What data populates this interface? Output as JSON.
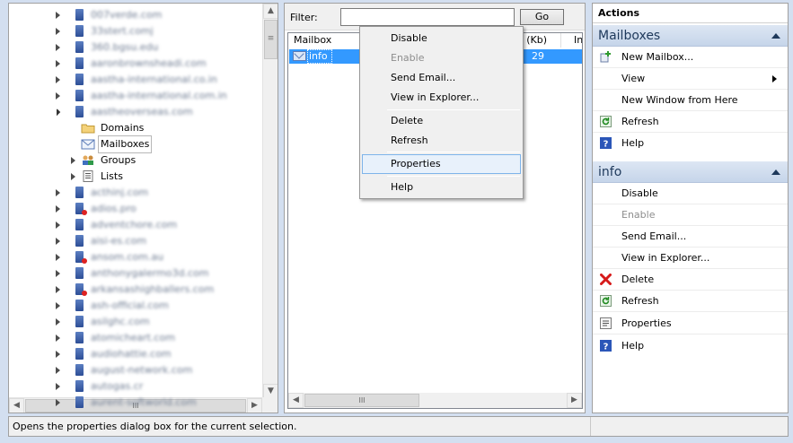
{
  "tree": {
    "domains_before": [
      "007verde.com",
      "33stert.comj",
      "360.bgsu.edu",
      "aaronbrownsheadi.com",
      "aastha-international.co.in",
      "aastha-international.com.in",
      "aastheoverseas.com"
    ],
    "children": [
      {
        "label": "Domains",
        "icon": "folder-icon"
      },
      {
        "label": "Mailboxes",
        "icon": "mailboxes-icon"
      },
      {
        "label": "Groups",
        "icon": "groups-icon"
      },
      {
        "label": "Lists",
        "icon": "lists-icon"
      }
    ],
    "domains_after": [
      {
        "label": "acthinj.com",
        "disabled": false
      },
      {
        "label": "adios.pro",
        "disabled": true
      },
      {
        "label": "adventchore.com",
        "disabled": false
      },
      {
        "label": "aisi-es.com",
        "disabled": false
      },
      {
        "label": "ansom.com.au",
        "disabled": true
      },
      {
        "label": "anthonygalermo3d.com",
        "disabled": false
      },
      {
        "label": "arkansashighballers.com",
        "disabled": true
      },
      {
        "label": "ash-official.com",
        "disabled": false
      },
      {
        "label": "asilghc.com",
        "disabled": false
      },
      {
        "label": "atomicheart.com",
        "disabled": false
      },
      {
        "label": "audiohattie.com",
        "disabled": false
      },
      {
        "label": "august-network.com",
        "disabled": false
      },
      {
        "label": "autogas.cr",
        "disabled": false
      },
      {
        "label": "aurent-softworld.com",
        "disabled": false
      }
    ]
  },
  "filter": {
    "label": "Filter:",
    "value": "",
    "go_label": "Go"
  },
  "list": {
    "columns": [
      "Mailbox",
      "ge (Kb)",
      "Inb"
    ],
    "rows": [
      {
        "name": "info",
        "size": "29"
      }
    ]
  },
  "context_menu": {
    "items": [
      "Disable",
      "Enable",
      "Send Email...",
      "View in Explorer...",
      "Delete",
      "Refresh",
      "Properties",
      "Help"
    ],
    "disabled": [
      "Enable"
    ],
    "hovered": "Properties"
  },
  "actions": {
    "title": "Actions",
    "groups": [
      {
        "header": "Mailboxes",
        "items": [
          {
            "label": "New Mailbox...",
            "icon": "add-icon"
          },
          {
            "label": "View",
            "icon": "",
            "submenu": true
          },
          {
            "label": "New Window from Here",
            "icon": ""
          },
          {
            "label": "Refresh",
            "icon": "refresh-icon"
          },
          {
            "label": "Help",
            "icon": "help-icon"
          }
        ]
      },
      {
        "header": "info",
        "items": [
          {
            "label": "Disable",
            "icon": ""
          },
          {
            "label": "Enable",
            "icon": "",
            "disabled": true
          },
          {
            "label": "Send Email...",
            "icon": ""
          },
          {
            "label": "View in Explorer...",
            "icon": ""
          },
          {
            "label": "Delete",
            "icon": "delete-icon"
          },
          {
            "label": "Refresh",
            "icon": "refresh-icon"
          },
          {
            "label": "Properties",
            "icon": "properties-icon"
          },
          {
            "label": "Help",
            "icon": "help-icon"
          }
        ]
      }
    ]
  },
  "status": {
    "text": "Opens the properties dialog box for the current selection."
  },
  "colors": {
    "selection": "#3399ff",
    "group_header": "#c6d5ea",
    "menu_hover": "#e8f1fb"
  }
}
